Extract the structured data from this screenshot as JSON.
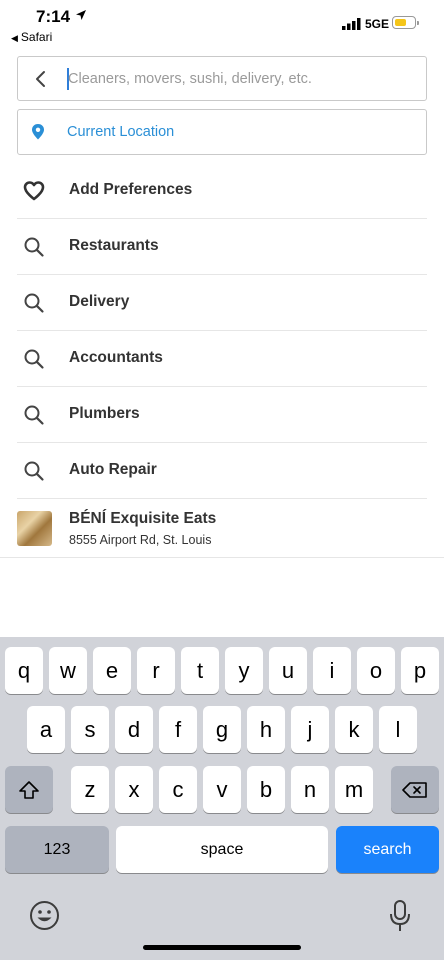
{
  "status_bar": {
    "time": "7:14",
    "back_app": "Safari",
    "network": "5GE"
  },
  "search": {
    "placeholder": "Cleaners, movers, sushi, delivery, etc.",
    "value": ""
  },
  "location": {
    "label": "Current Location"
  },
  "list": [
    {
      "icon": "heart-icon",
      "label": "Add Preferences"
    },
    {
      "icon": "search-icon",
      "label": "Restaurants"
    },
    {
      "icon": "search-icon",
      "label": "Delivery"
    },
    {
      "icon": "search-icon",
      "label": "Accountants"
    },
    {
      "icon": "search-icon",
      "label": "Plumbers"
    },
    {
      "icon": "search-icon",
      "label": "Auto Repair"
    }
  ],
  "business": {
    "name": "BÉNÍ Exquisite Eats",
    "address": "8555 Airport Rd, St. Louis"
  },
  "keyboard": {
    "row1": [
      "q",
      "w",
      "e",
      "r",
      "t",
      "y",
      "u",
      "i",
      "o",
      "p"
    ],
    "row2": [
      "a",
      "s",
      "d",
      "f",
      "g",
      "h",
      "j",
      "k",
      "l"
    ],
    "row3": [
      "z",
      "x",
      "c",
      "v",
      "b",
      "n",
      "m"
    ],
    "numbers_label": "123",
    "space_label": "space",
    "search_label": "search"
  },
  "colors": {
    "accent": "#2a8fd6",
    "key_blue": "#1a82fb",
    "battery": "#f5c518"
  }
}
